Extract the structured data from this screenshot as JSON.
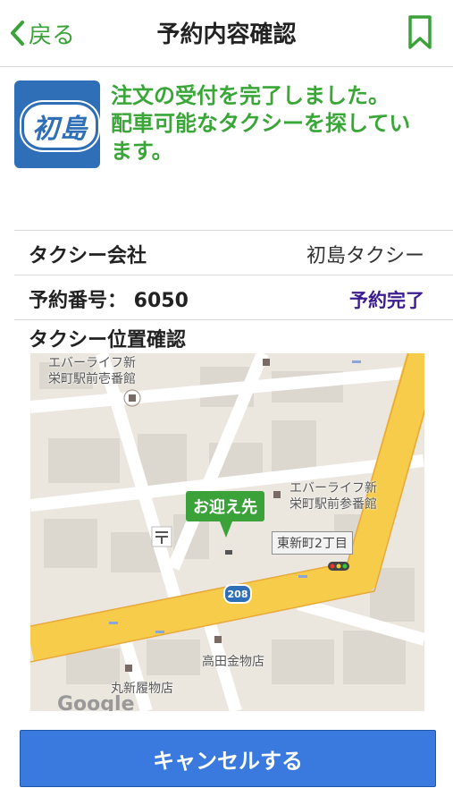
{
  "nav": {
    "back_label": "戻る",
    "title": "予約内容確認"
  },
  "logo": {
    "text": "初島"
  },
  "message": {
    "line1": "注文の受付を完了しました。",
    "line2": "配車可能なタクシーを探してい",
    "line3": "ます。"
  },
  "details": {
    "company_label": "タクシー会社",
    "company_value": "初島タクシー",
    "booking_label": "予約番号： 6050",
    "status": "予約完了",
    "map_label": "タクシー位置確認"
  },
  "map": {
    "pickup_label": "お迎え先",
    "poi1": "エバーライフ新\n栄町駅前壱番館",
    "poi2": "エバーライフ新\n栄町駅前参番館",
    "street_label": "東新町2丁目",
    "route_number": "208",
    "poi3": "高田金物店",
    "poi4": "丸新履物店",
    "attribution": "Google"
  },
  "buttons": {
    "cancel": "キャンセルする"
  },
  "colors": {
    "accent": "#39a637",
    "button": "#3a79dd",
    "status": "#3c1c8f",
    "road": "#f6cc4a"
  }
}
